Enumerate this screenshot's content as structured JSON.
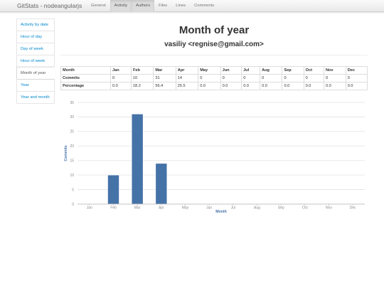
{
  "navbar": {
    "brand": "GitStats - nodeangularjs",
    "items": [
      {
        "label": "General",
        "active": false
      },
      {
        "label": "Activity",
        "active": true
      },
      {
        "label": "Authors",
        "active": true
      },
      {
        "label": "Files",
        "active": false
      },
      {
        "label": "Lines",
        "active": false
      },
      {
        "label": "Comments",
        "active": false
      }
    ]
  },
  "sidebar": {
    "items": [
      {
        "label": "Activity by date",
        "active": false
      },
      {
        "label": "Hour of day",
        "active": false
      },
      {
        "label": "Day of week",
        "active": false
      },
      {
        "label": "Hour of week",
        "active": false
      },
      {
        "label": "Month of year",
        "active": true
      },
      {
        "label": "Year",
        "active": false
      },
      {
        "label": "Year and month",
        "active": false
      }
    ]
  },
  "main": {
    "title": "Month of year",
    "subtitle": "vasiliy <regnise@gmail.com>"
  },
  "table": {
    "header": [
      "Month",
      "Jan",
      "Feb",
      "Mar",
      "Apr",
      "May",
      "Jun",
      "Jul",
      "Aug",
      "Sep",
      "Oct",
      "Nov",
      "Dec"
    ],
    "rows": [
      [
        "Commits",
        "0",
        "10",
        "31",
        "14",
        "0",
        "0",
        "0",
        "0",
        "0",
        "0",
        "0",
        "0"
      ],
      [
        "Percentage",
        "0.0",
        "18.2",
        "56.4",
        "25.5",
        "0.0",
        "0.0",
        "0.0",
        "0.0",
        "0.0",
        "0.0",
        "0.0",
        "0.0"
      ]
    ]
  },
  "chart_data": {
    "type": "bar",
    "categories": [
      "Jan",
      "Feb",
      "Mar",
      "Apr",
      "May",
      "Jun",
      "Jul",
      "Aug",
      "Sep",
      "Oct",
      "Nov",
      "Dec"
    ],
    "values": [
      0,
      10,
      31,
      14,
      0,
      0,
      0,
      0,
      0,
      0,
      0,
      0
    ],
    "xlabel": "Month",
    "ylabel": "Commits",
    "ylim": [
      0,
      35
    ],
    "yticks": [
      0,
      5,
      10,
      15,
      20,
      25,
      30,
      35
    ],
    "grid": true,
    "bar_color": "#4572a7",
    "axis_title_color": "#4572a7"
  }
}
